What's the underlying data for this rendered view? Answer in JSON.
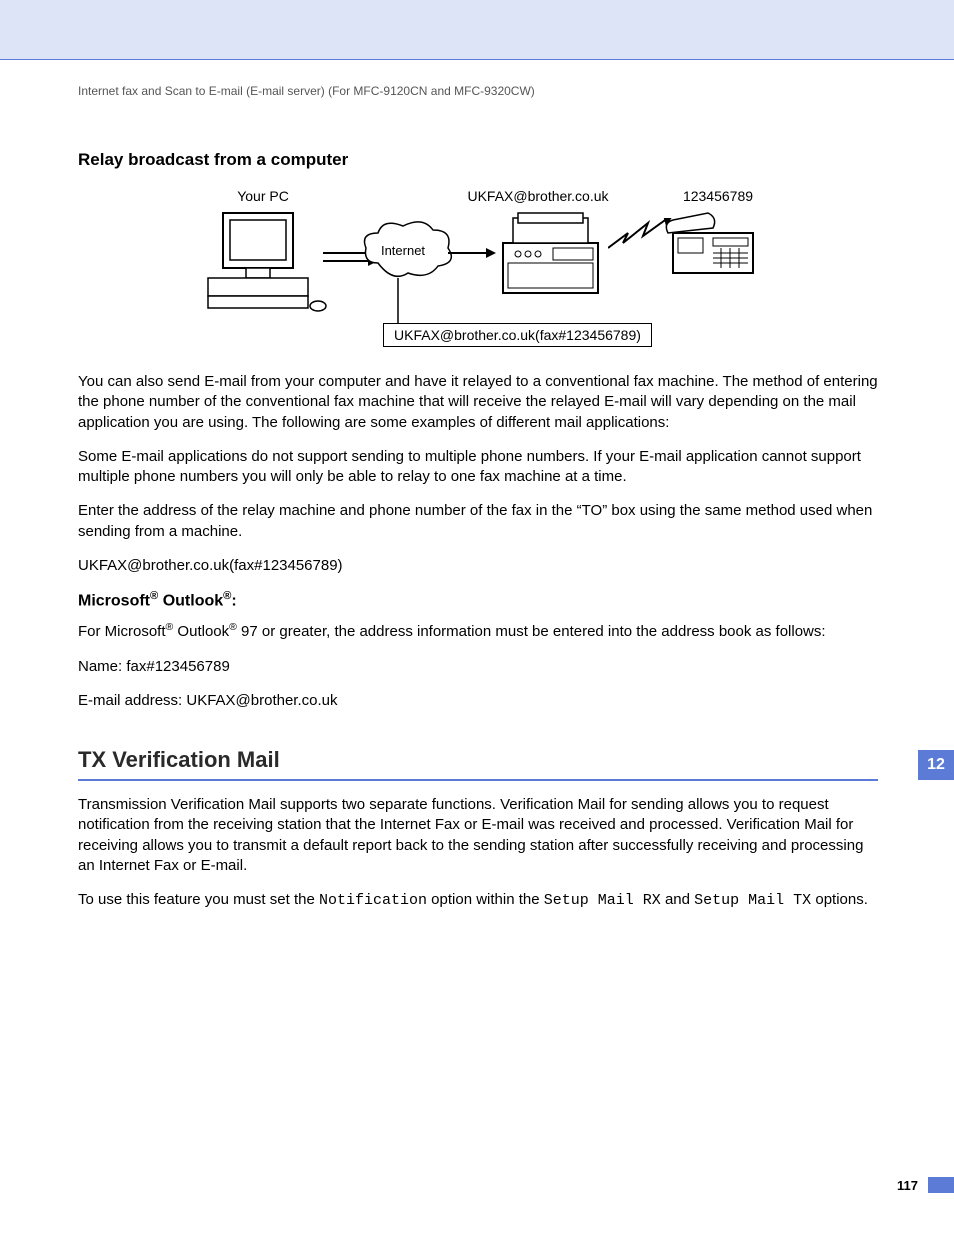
{
  "header": {
    "breadcrumb": "Internet fax and Scan to E-mail (E-mail server) (For MFC-9120CN and MFC-9320CW)"
  },
  "section1": {
    "title": "Relay broadcast from a computer",
    "diagram": {
      "pc_label": "Your PC",
      "relay_label": "UKFAX@brother.co.uk",
      "fax_label": "123456789",
      "cloud_label": "Internet",
      "address_box": "UKFAX@brother.co.uk(fax#123456789)"
    },
    "p1": "You can also send E-mail from your computer and have it relayed to a conventional fax machine. The method of entering the phone number of the conventional fax machine that will receive the relayed E-mail will vary depending on the mail application you are using. The following are some examples of different mail applications:",
    "p2": "Some E-mail applications do not support sending to multiple phone numbers. If your E-mail application cannot support multiple phone numbers you will only be able to relay to one fax machine at a time.",
    "p3": "Enter the address of the relay machine and phone number of the fax in the “TO” box using the same method used when sending from a machine.",
    "p4": "UKFAX@brother.co.uk(fax#123456789)"
  },
  "section2": {
    "title_pre": "Microsoft",
    "title_mid": " Outlook",
    "title_suf": ":",
    "p1_pre": "For Microsoft",
    "p1_mid": " Outlook",
    "p1_suf": " 97 or greater, the address information must be entered into the address book as follows:",
    "p2": "Name: fax#123456789",
    "p3": "E-mail address: UKFAX@brother.co.uk"
  },
  "section3": {
    "title": "TX Verification Mail",
    "p1": "Transmission Verification Mail supports two separate functions. Verification Mail for sending allows you to request notification from the receiving station that the Internet Fax or E-mail was received and processed. Verification Mail for receiving allows you to transmit a default report back to the sending station after successfully receiving and processing an Internet Fax or E-mail.",
    "p2_a": "To use this feature you must set the ",
    "p2_code1": "Notification",
    "p2_b": " option within the ",
    "p2_code2": "Setup Mail RX",
    "p2_c": " and ",
    "p2_code3": "Setup Mail TX",
    "p2_d": " options."
  },
  "chapter_tab": "12",
  "page_number": "117"
}
